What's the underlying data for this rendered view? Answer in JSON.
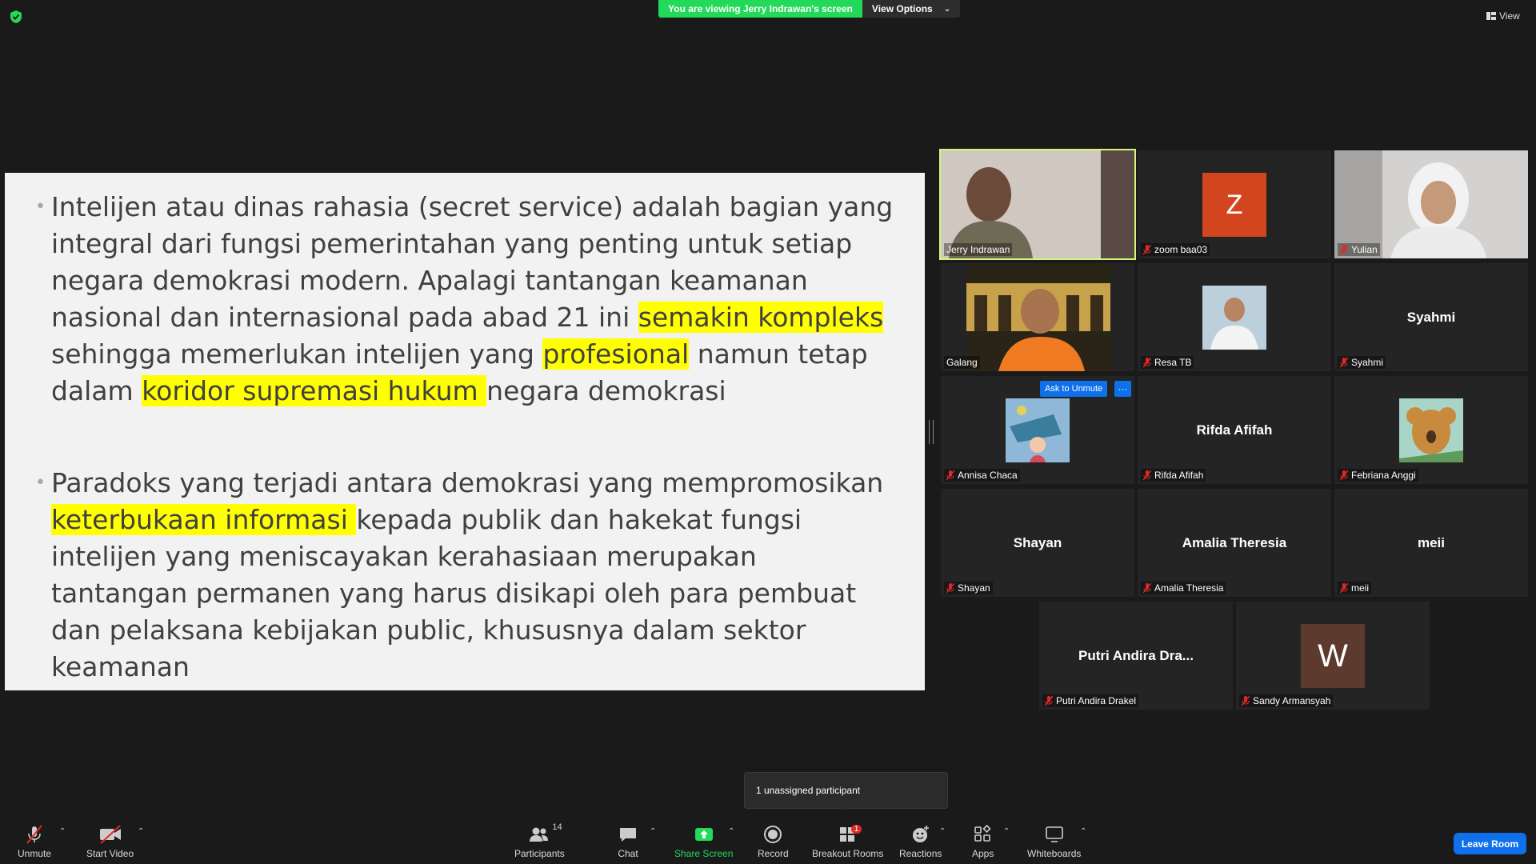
{
  "top": {
    "banner_text": "You are viewing Jerry Indrawan's screen",
    "view_options": "View Options",
    "view_label": "View"
  },
  "slide": {
    "bullet1": {
      "p1": "Intelijen atau dinas rahasia (secret service) adalah bagian yang integral dari fungsi pemerintahan yang penting untuk setiap negara demokrasi modern. Apalagi tantangan keamanan nasional dan internasional pada abad 21 ini ",
      "h1": "semakin kompleks ",
      "p2": "sehingga memerlukan intelijen yang ",
      "h2": "profesional",
      "p3": " namun tetap dalam ",
      "h3": "koridor supremasi hukum ",
      "p4": "negara demokrasi"
    },
    "bullet2": {
      "p1": "Paradoks yang terjadi antara demokrasi yang mempromosikan ",
      "h1": "keterbukaan informasi ",
      "p2": "kepada publik dan hakekat fungsi intelijen yang meniscayakan kerahasiaan merupakan tantangan permanen yang harus disikapi oleh para pembuat dan pelaksana kebijakan public, khususnya dalam sektor keamanan"
    }
  },
  "participants": [
    {
      "name": "Jerry Indrawan",
      "type": "video"
    },
    {
      "name": "zoom baa03",
      "type": "letter",
      "letter": "Z",
      "color": "#d3451f"
    },
    {
      "name": "Yulian",
      "type": "video"
    },
    {
      "name": "Galang",
      "type": "video"
    },
    {
      "name": "Resa TB",
      "type": "photo"
    },
    {
      "name": "Syahmi",
      "type": "name",
      "display": "Syahmi"
    },
    {
      "name": "Annisa Chaca",
      "type": "photo"
    },
    {
      "name": "Rifda Afifah",
      "type": "name",
      "display": "Rifda Afifah"
    },
    {
      "name": "Febriana Anggi",
      "type": "photo"
    },
    {
      "name": "Shayan",
      "type": "name",
      "display": "Shayan"
    },
    {
      "name": "Amalia Theresia",
      "type": "name",
      "display": "Amalia Theresia"
    },
    {
      "name": "meii",
      "type": "name",
      "display": "meii"
    },
    {
      "name": "Putri Andira Drakel",
      "type": "name",
      "display": "Putri Andira Dra..."
    },
    {
      "name": "Sandy Armansyah",
      "type": "letter",
      "letter": "W",
      "color": "#5c3a2e"
    }
  ],
  "ask_to_unmute": "Ask to Unmute",
  "more": "···",
  "popup": {
    "text": "1 unassigned participant"
  },
  "toolbar": {
    "unmute": "Unmute",
    "start_video": "Start Video",
    "participants": "Participants",
    "participants_count": "14",
    "chat": "Chat",
    "share_screen": "Share Screen",
    "record": "Record",
    "breakout_rooms": "Breakout Rooms",
    "breakout_badge": "1",
    "reactions": "Reactions",
    "apps": "Apps",
    "whiteboards": "Whiteboards",
    "leave": "Leave Room"
  },
  "colors": {
    "banner_green": "#23d959",
    "highlight": "#ffff00",
    "accent_blue": "#0e71eb",
    "muted_red": "#e02828",
    "active_speaker": "#d6f57a"
  }
}
